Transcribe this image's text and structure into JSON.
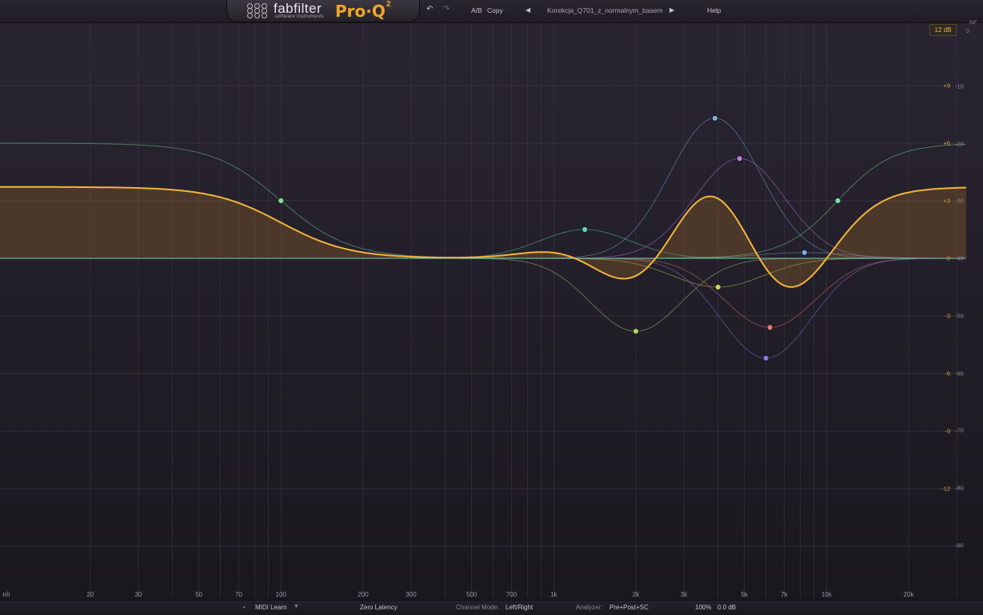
{
  "app": {
    "brand": "fabfilter",
    "brand_sub": "software instruments",
    "product": "Pro·Q",
    "product_version": "2"
  },
  "toolbar": {
    "undo_icon": "undo-icon",
    "redo_icon": "redo-icon",
    "ab_label": "A/B",
    "copy_label": "Copy",
    "prev_preset_icon": "triangle-left-icon",
    "preset_name": "Korekcja_Q701_z_normalnym_basem",
    "next_preset_icon": "triangle-right-icon",
    "help_label": "Help"
  },
  "display": {
    "range_label": "12 dB",
    "analyzer_top_label": "0",
    "infinity_label": "INF",
    "freq_labels": [
      "20",
      "30",
      "50",
      "70",
      "100",
      "200",
      "300",
      "500",
      "700",
      "1k",
      "2k",
      "3k",
      "5k",
      "7k",
      "10k",
      "20k"
    ],
    "eq_db_labels": [
      "+9",
      "+6",
      "+3",
      "0",
      "-3",
      "-6",
      "-9",
      "-12"
    ],
    "analyzer_db_labels": [
      "-10",
      "-20",
      "-30",
      "-40",
      "-50",
      "-60",
      "-70",
      "-80",
      "-90"
    ]
  },
  "bands": [
    {
      "id": 1,
      "type": "low-shelf",
      "freq_hz": 100,
      "gain_db": 3,
      "color": "#7fe0a0"
    },
    {
      "id": 2,
      "type": "bell",
      "freq_hz": 1300,
      "gain_db": 1.5,
      "color": "#5ad8b0"
    },
    {
      "id": 3,
      "type": "bell",
      "freq_hz": 2000,
      "gain_db": -3.8,
      "color": "#a6d86a"
    },
    {
      "id": 4,
      "type": "bell",
      "freq_hz": 3900,
      "gain_db": 7.3,
      "color": "#7ab0e0"
    },
    {
      "id": 5,
      "type": "bell",
      "freq_hz": 4000,
      "gain_db": -1.5,
      "color": "#c6d85a"
    },
    {
      "id": 6,
      "type": "bell",
      "freq_hz": 4800,
      "gain_db": 5.2,
      "color": "#c27ae0"
    },
    {
      "id": 7,
      "type": "bell",
      "freq_hz": 6200,
      "gain_db": -3.6,
      "color": "#e07a7a"
    },
    {
      "id": 8,
      "type": "bell",
      "freq_hz": 6000,
      "gain_db": -5.2,
      "color": "#8a7ae0"
    },
    {
      "id": 9,
      "type": "bell",
      "freq_hz": 8300,
      "gain_db": 0.3,
      "color": "#7ab0e0"
    },
    {
      "id": 10,
      "type": "high-shelf",
      "freq_hz": 11000,
      "gain_db": 3,
      "color": "#7fe0a0"
    }
  ],
  "colors": {
    "eq_curve": "#f2b53c",
    "eq_fill": "rgba(180,120,40,0.28)",
    "accent": "#f0a42c"
  },
  "statusbar": {
    "midi_learn": "MIDI Learn",
    "latency": "Zero Latency",
    "channel_mode_label": "Channel Mode:",
    "channel_mode_value": "Left/Right",
    "analyzer_label": "Analyzer:",
    "analyzer_value": "Pre+Post+SC",
    "zoom": "100%",
    "output_gain": "0.0 dB"
  }
}
